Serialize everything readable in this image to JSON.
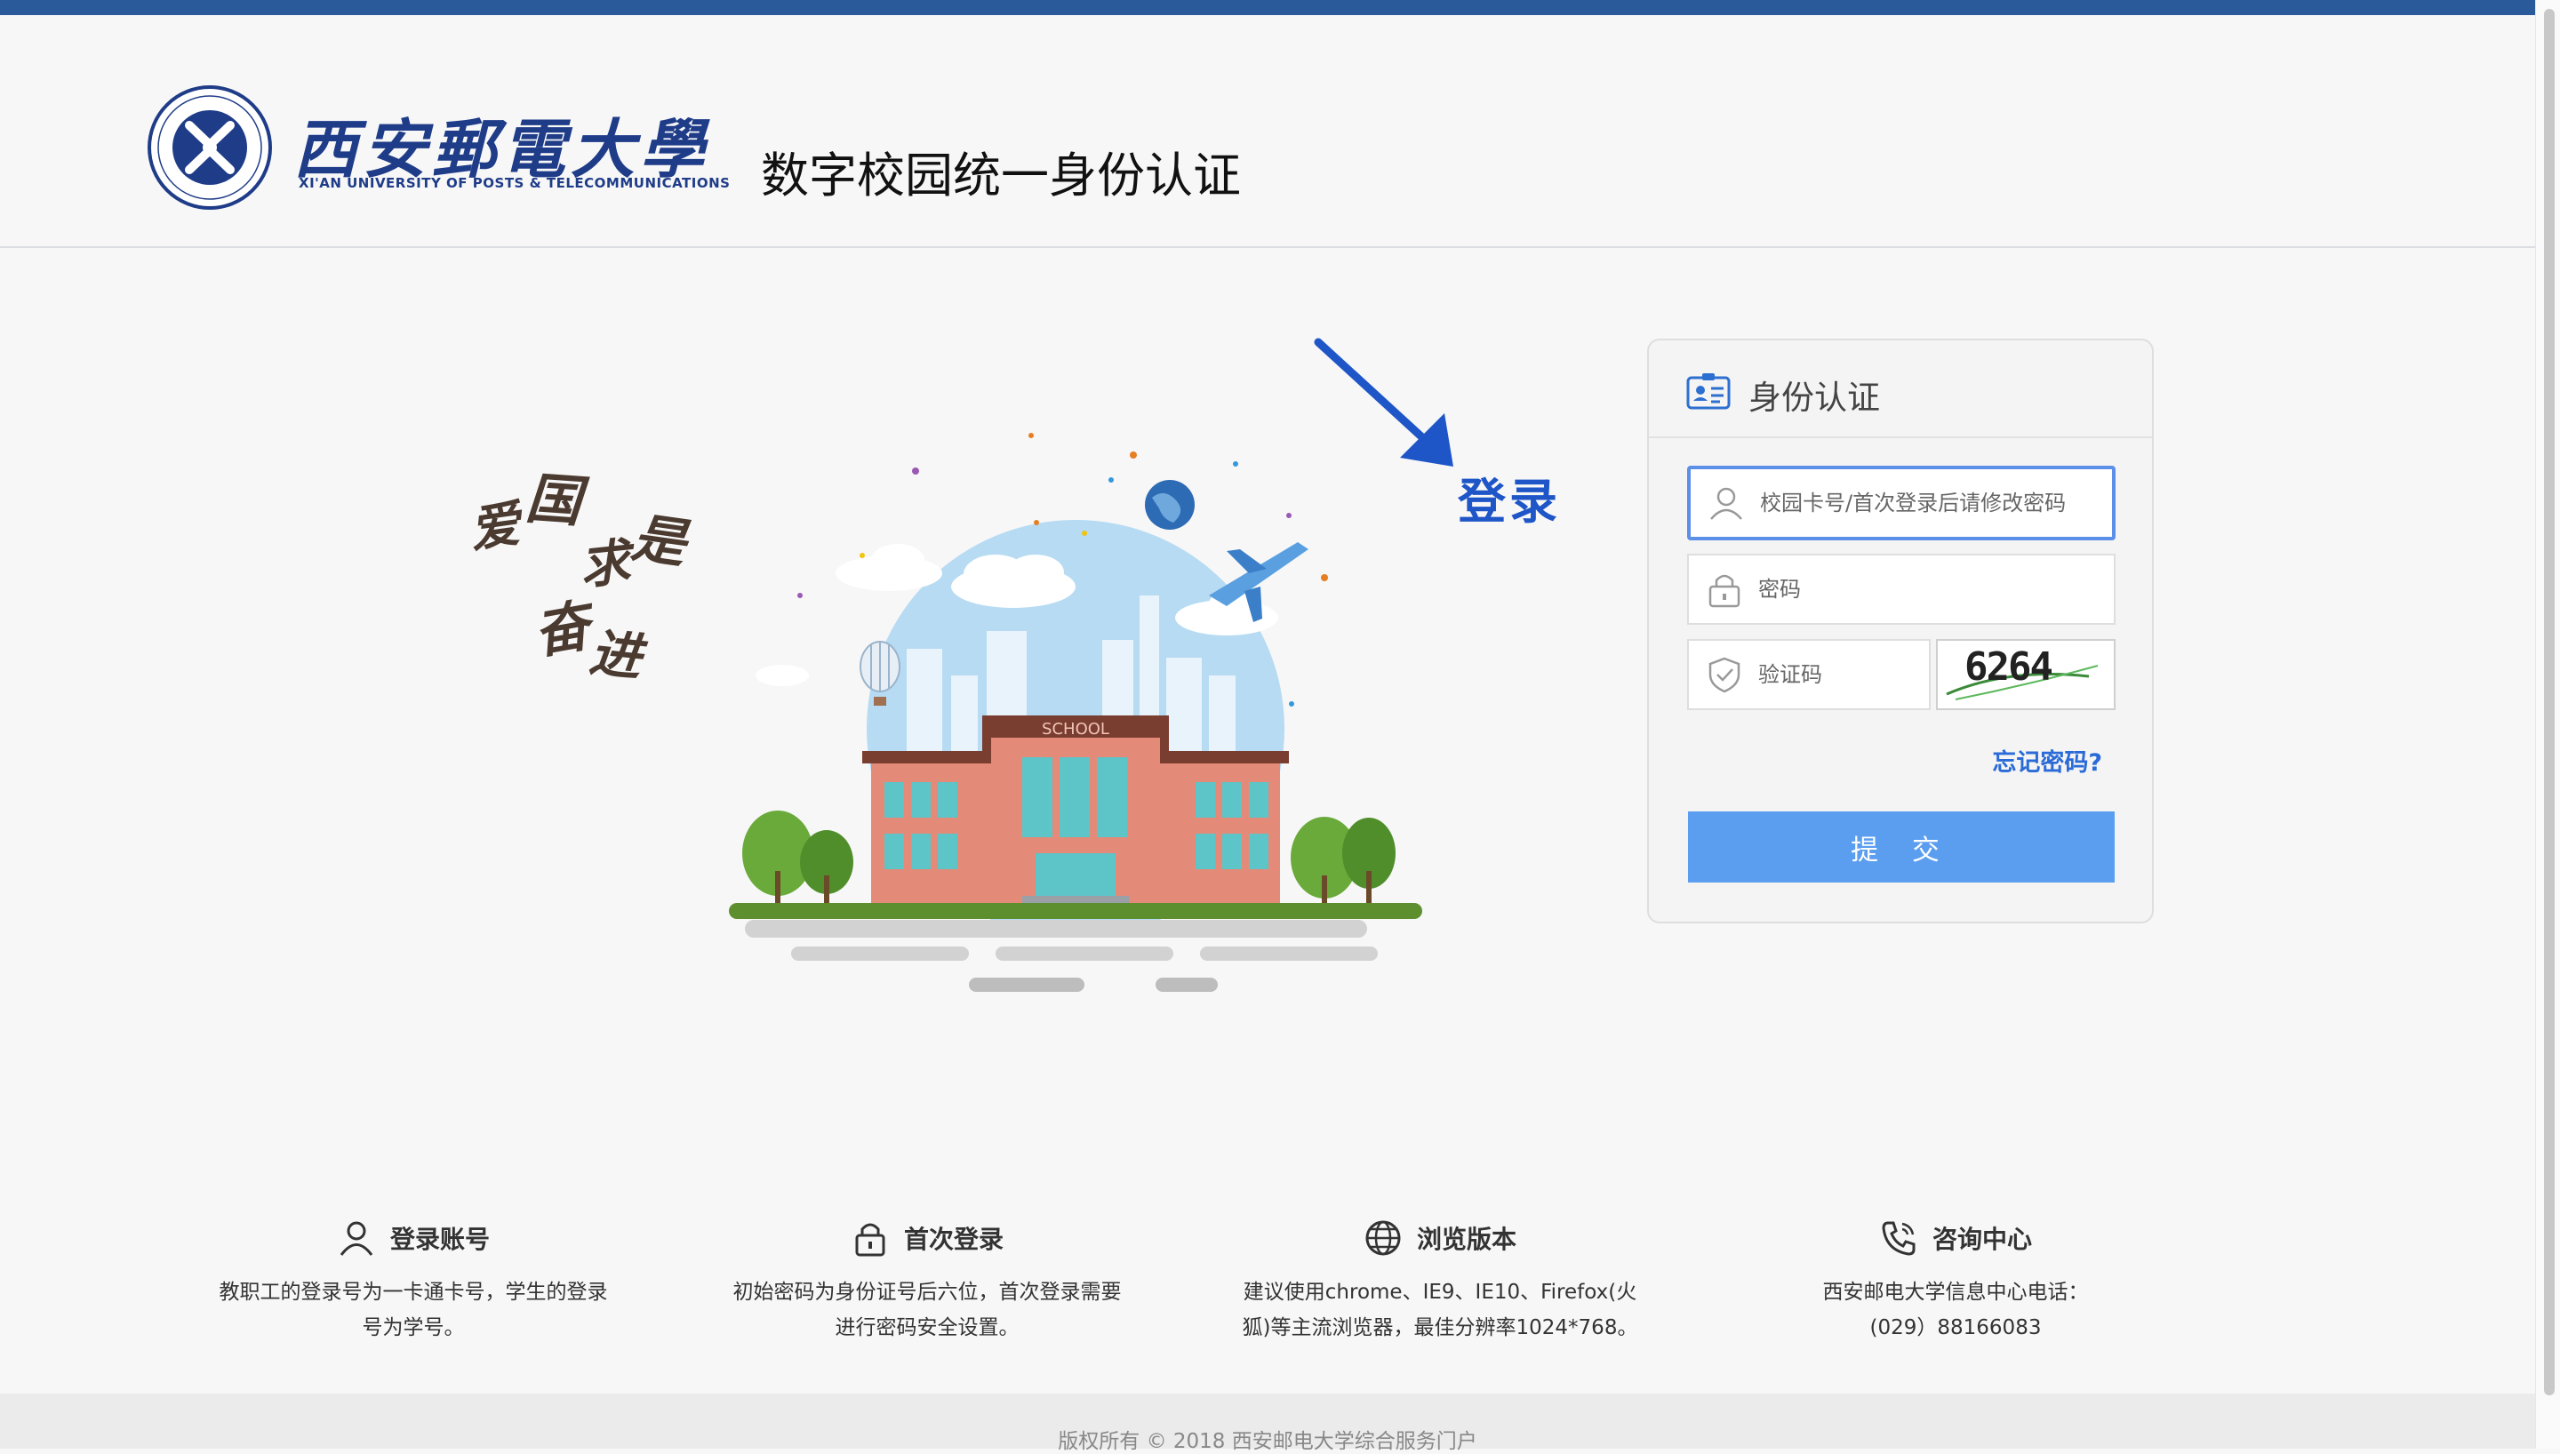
{
  "header": {
    "logo_cn": "西安郵電大學",
    "logo_en": "XI'AN UNIVERSITY OF POSTS & TELECOMMUNICATIONS",
    "system_title": "数字校园统一身份认证"
  },
  "slogan": [
    "爱",
    "国",
    "求",
    "是",
    "奋",
    "进"
  ],
  "illustration": {
    "school_sign": "SCHOOL"
  },
  "annotation": {
    "label": "登录",
    "color": "#1e56c8"
  },
  "login": {
    "title": "身份认证",
    "username_placeholder": "校园卡号/首次登录后请修改密码",
    "password_placeholder": "密码",
    "captcha_placeholder": "验证码",
    "captcha_value": "6264",
    "forgot_label": "忘记密码?",
    "submit_label": "提 交",
    "accent_color": "#5b9ef0"
  },
  "info": [
    {
      "icon": "user-icon",
      "title": "登录账号",
      "lines": [
        "教职工的登录号为一卡通卡号，学生的登录",
        "号为学号。"
      ]
    },
    {
      "icon": "lock-icon",
      "title": "首次登录",
      "lines": [
        "初始密码为身份证号后六位，首次登录需要",
        "进行密码安全设置。"
      ]
    },
    {
      "icon": "globe-icon",
      "title": "浏览版本",
      "lines": [
        "建议使用chrome、IE9、IE10、Firefox(火",
        "狐)等主流浏览器，最佳分辨率1024*768。"
      ]
    },
    {
      "icon": "phone-icon",
      "title": "咨询中心",
      "lines": [
        "西安邮电大学信息中心电话：",
        "(029）88166083"
      ]
    }
  ],
  "footer": {
    "copyright": "版权所有 © 2018 西安邮电大学综合服务门户"
  },
  "colors": {
    "topbar": "#2a5a9a",
    "brand_blue": "#1f3c88",
    "link_blue": "#2a6bd8"
  }
}
